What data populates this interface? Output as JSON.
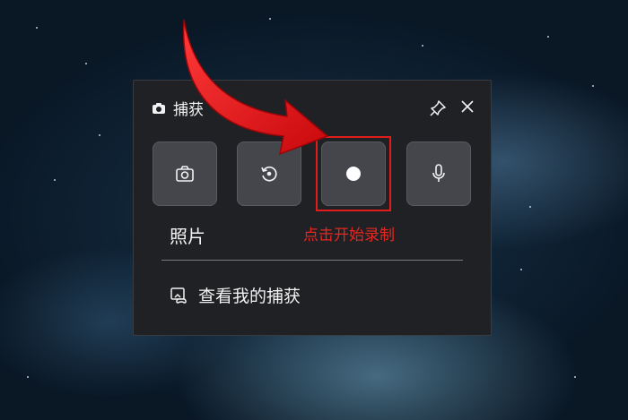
{
  "panel": {
    "title": "捕获",
    "icons": {
      "title": "camera-icon",
      "pin": "pin-icon",
      "close": "close-icon"
    }
  },
  "tools": [
    {
      "name": "screenshot-button",
      "icon": "camera-icon",
      "label": "照片"
    },
    {
      "name": "record-last-button",
      "icon": "replay-icon"
    },
    {
      "name": "start-recording-button",
      "icon": "record-dot-icon"
    },
    {
      "name": "microphone-button",
      "icon": "microphone-icon"
    }
  ],
  "annotation": {
    "text": "点击开始录制",
    "color": "#e8261f"
  },
  "gallery": {
    "label": "查看我的捕获",
    "icon": "gallery-gamepad-icon"
  },
  "colors": {
    "panel_bg": "#202124",
    "tile_bg": "#45464b",
    "highlight": "#e21b1b",
    "arrow": "#e8161b"
  }
}
